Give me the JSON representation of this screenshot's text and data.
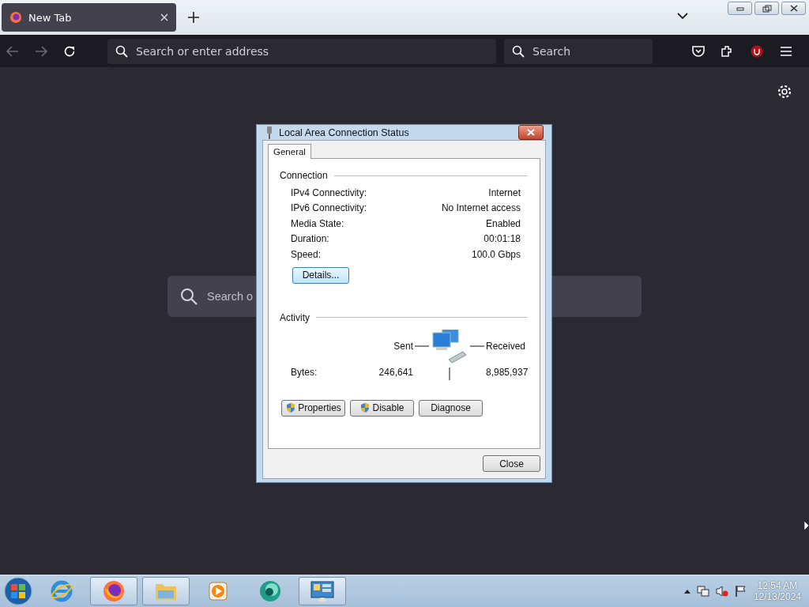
{
  "browser": {
    "tabs": [
      {
        "title": "New Tab",
        "selected": true
      }
    ],
    "address": {
      "placeholder": "Search or enter address"
    },
    "search": {
      "placeholder": "Search"
    },
    "page_search": {
      "placeholder": "Search o"
    }
  },
  "dialog": {
    "title": "Local Area Connection Status",
    "tabs": [
      {
        "label": "General",
        "selected": true
      }
    ],
    "connection": {
      "heading": "Connection",
      "rows": [
        {
          "label": "IPv4 Connectivity:",
          "value": "Internet"
        },
        {
          "label": "IPv6 Connectivity:",
          "value": "No Internet access"
        },
        {
          "label": "Media State:",
          "value": "Enabled"
        },
        {
          "label": "Duration:",
          "value": "00:01:18"
        },
        {
          "label": "Speed:",
          "value": "100.0 Gbps"
        }
      ],
      "details_button": "Details..."
    },
    "activity": {
      "heading": "Activity",
      "sent_label": "Sent",
      "received_label": "Received",
      "bytes_label": "Bytes:",
      "sent": "246,641",
      "received": "8,985,937"
    },
    "buttons": [
      {
        "label": "Properties",
        "kind": "shield"
      },
      {
        "label": "Disable",
        "kind": "shield"
      },
      {
        "label": "Diagnose",
        "kind": "plain"
      }
    ],
    "close_button": "Close"
  },
  "taskbar": {
    "items": [
      {
        "kind": "ie",
        "open": false
      },
      {
        "kind": "firefox",
        "open": true
      },
      {
        "kind": "explorer",
        "open": true
      },
      {
        "kind": "media",
        "open": false
      },
      {
        "kind": "app",
        "open": false
      },
      {
        "kind": "control",
        "open": true
      }
    ],
    "time": "12:54 AM",
    "date": "12/13/2024"
  }
}
